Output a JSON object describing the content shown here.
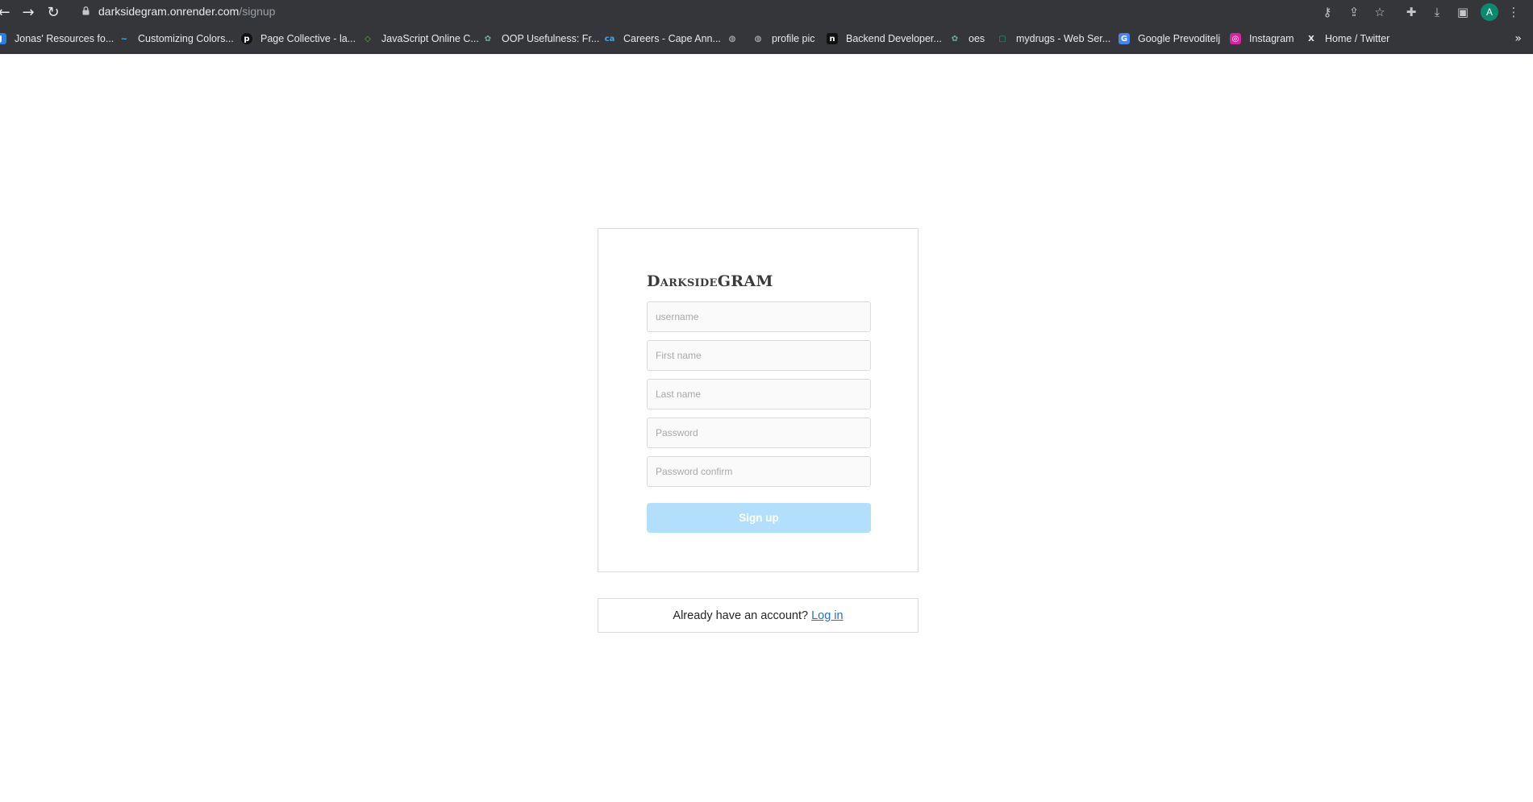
{
  "browser": {
    "url_host": "darksidegram.onrender.com",
    "url_path": "/signup",
    "avatar_letter": "A",
    "icons": {
      "back": "arrow-left-icon",
      "forward": "arrow-right-icon",
      "reload": "reload-icon",
      "lock": "lock-icon",
      "key": "key-icon",
      "share": "share-icon",
      "star": "star-icon",
      "extensions": "puzzle-icon",
      "download": "download-icon",
      "sidepanel": "side-panel-icon",
      "menu": "kebab-menu-icon"
    },
    "bookmarks": [
      {
        "label": "Jonas' Resources fo...",
        "icon": "J",
        "color": "#2b7de9"
      },
      {
        "label": "Customizing Colors...",
        "icon": "~",
        "color": "#38bdf8"
      },
      {
        "label": "Page Collective - la...",
        "icon": "p",
        "color": "#111111"
      },
      {
        "label": "JavaScript Online C...",
        "icon": "◇",
        "color": "#5fb832"
      },
      {
        "label": "OOP Usefulness: Fr...",
        "icon": "✿",
        "color": "#74aa9c"
      },
      {
        "label": "Careers - Cape Ann...",
        "icon": "ca",
        "color": "#4aa3df"
      },
      {
        "label": "",
        "icon": "◍",
        "color": "#6b6f73"
      },
      {
        "label": "profile pic",
        "icon": "◍",
        "color": "#6b6f73"
      },
      {
        "label": "Backend Developer...",
        "icon": "n",
        "color": "#111111"
      },
      {
        "label": "oes",
        "icon": "✿",
        "color": "#74aa9c"
      },
      {
        "label": "mydrugs - Web Ser...",
        "icon": "▢",
        "color": "#1aa37a"
      },
      {
        "label": "Google Prevoditelj",
        "icon": "G",
        "color": "#4285f4"
      },
      {
        "label": "Instagram",
        "icon": "◎",
        "color": "#d6249f"
      },
      {
        "label": "Home / Twitter",
        "icon": "X",
        "color": "#000000"
      }
    ],
    "more_label": "»"
  },
  "signup": {
    "logo": "DarksideGRAM",
    "placeholders": {
      "username": "username",
      "first_name": "First name",
      "last_name": "Last name",
      "password": "Password",
      "password_confirm": "Password confirm"
    },
    "submit_label": "Sign up",
    "submit_color": "#b2dffc"
  },
  "login_prompt": {
    "text": "Already have an account?",
    "link": "Log in",
    "link_color": "#1f6fd1"
  }
}
